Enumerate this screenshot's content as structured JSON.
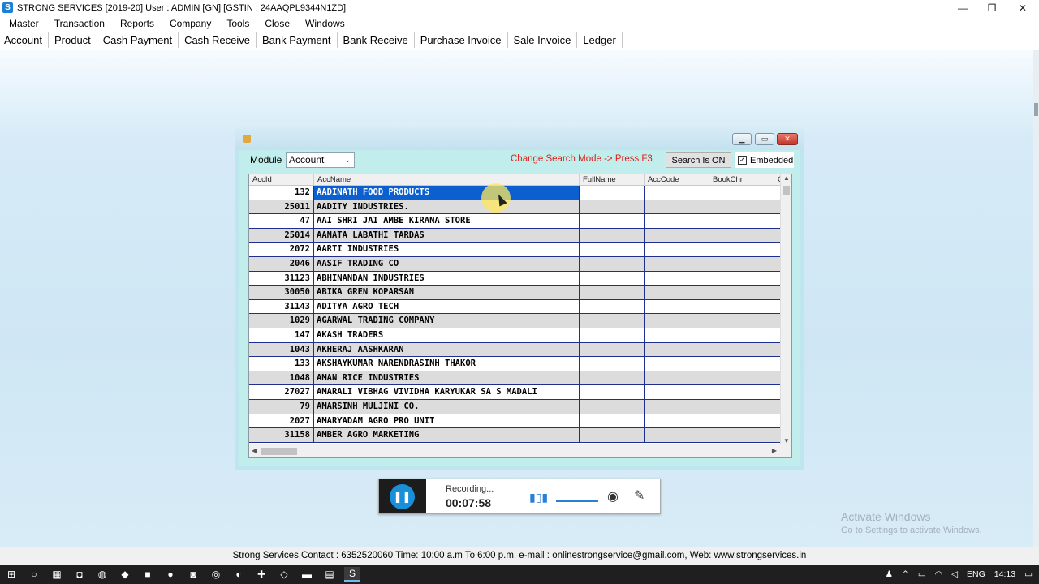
{
  "window": {
    "title": "STRONG SERVICES [2019-20]  User : ADMIN [GN] [GSTIN : 24AAQPL9344N1ZD]",
    "app_icon_glyph": "S",
    "controls": {
      "minimize": "—",
      "restore": "❐",
      "close": "✕"
    }
  },
  "menu": [
    "Master",
    "Transaction",
    "Reports",
    "Company",
    "Tools",
    "Close",
    "Windows"
  ],
  "toolbar": [
    "Account",
    "Product",
    "Cash Payment",
    "Cash Receive",
    "Bank Payment",
    "Bank Receive",
    "Purchase Invoice",
    "Sale Invoice",
    "Ledger"
  ],
  "child_window": {
    "module_label": "Module",
    "module_value": "Account",
    "search_hint": "Change Search Mode -> Press F3",
    "search_button": "Search Is ON",
    "embedded_label": "Embedded",
    "embedded_checked": true,
    "columns": [
      "AccId",
      "AccName",
      "FullName",
      "AccCode",
      "BookChr",
      "G"
    ],
    "rows": [
      {
        "id": "132",
        "name": "AADINATH FOOD PRODUCTS",
        "selected": true
      },
      {
        "id": "25011",
        "name": "AADITY INDUSTRIES."
      },
      {
        "id": "47",
        "name": "AAI SHRI JAI AMBE KIRANA STORE"
      },
      {
        "id": "25014",
        "name": "AANATA LABATHI  TARDAS"
      },
      {
        "id": "2072",
        "name": "AARTI INDUSTRIES"
      },
      {
        "id": "2046",
        "name": "AASIF TRADING CO"
      },
      {
        "id": "31123",
        "name": "ABHINANDAN INDUSTRIES"
      },
      {
        "id": "30050",
        "name": "ABIKA GREN KOPARSAN"
      },
      {
        "id": "31143",
        "name": "ADITYA AGRO TECH"
      },
      {
        "id": "1029",
        "name": "AGARWAL TRADING COMPANY"
      },
      {
        "id": "147",
        "name": "AKASH TRADERS"
      },
      {
        "id": "1043",
        "name": "AKHERAJ AASHKARAN"
      },
      {
        "id": "133",
        "name": "AKSHAYKUMAR NARENDRASINH THAKOR"
      },
      {
        "id": "1048",
        "name": "AMAN RICE INDUSTRIES"
      },
      {
        "id": "27027",
        "name": "AMARALI VIBHAG VIVIDHA KARYUKAR SA S MADALI"
      },
      {
        "id": "79",
        "name": "AMARSINH MULJINI CO."
      },
      {
        "id": "2027",
        "name": "AMARYADAM AGRO PRO UNIT"
      },
      {
        "id": "31158",
        "name": "AMBER AGRO MARKETING"
      }
    ]
  },
  "recorder": {
    "status": "Recording...",
    "time": "00:07:58"
  },
  "watermark": {
    "line1": "Activate Windows",
    "line2": "Go to Settings to activate Windows."
  },
  "statusbar": "Strong Services,Contact : 6352520060 Time: 10:00 a.m To 6:00 p.m, e-mail : onlinestrongservice@gmail.com, Web: www.strongservices.in",
  "taskbar": {
    "language": "ENG",
    "clock": "14:13"
  }
}
